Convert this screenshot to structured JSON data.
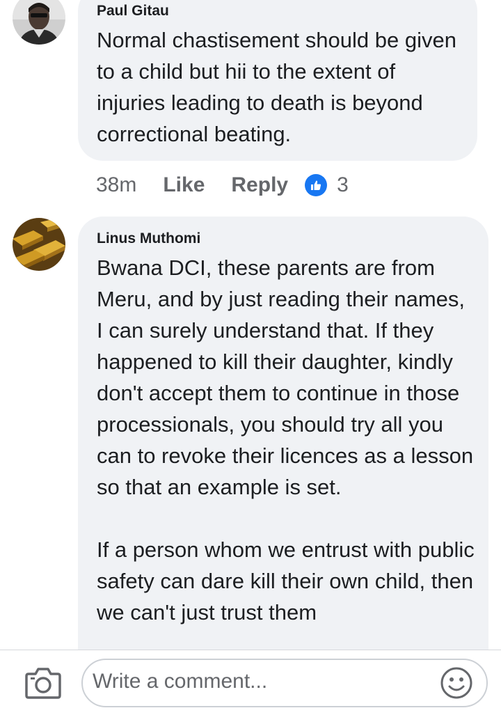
{
  "comments": [
    {
      "author": "Paul Gitau",
      "avatar_icon": "user-avatar-icon",
      "text": "Normal chastisement should be given to a child but hii to the extent of injuries leading to death is beyond correctional beating.",
      "time": "38m",
      "like_label": "Like",
      "reply_label": "Reply",
      "reactions_icon": "thumbs-up-icon",
      "reactions_count": "3"
    },
    {
      "author": "Linus Muthomi",
      "avatar_icon": "gold-bars-avatar-icon",
      "paragraphs": [
        "Bwana DCI, these parents are from Meru, and by just reading their names, I can surely understand that. If they happened to kill their daughter, kindly don't accept them to continue in those processionals, you should try all you can to revoke their licences as a lesson so that an example is set.",
        "If a person whom we entrust with public safety can dare kill their own child, then we can't just trust them"
      ]
    }
  ],
  "composer": {
    "placeholder": "Write a comment...",
    "camera_icon": "camera-icon",
    "emoji_icon": "smiley-icon"
  },
  "colors": {
    "bubble_bg": "#f0f2f5",
    "text": "#1c1e21",
    "secondary_text": "#65676b",
    "like_blue": "#1877f2"
  }
}
